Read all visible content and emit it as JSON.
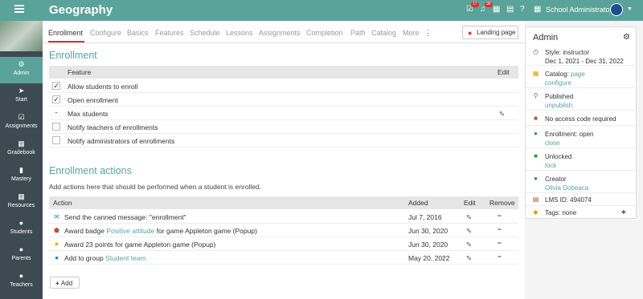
{
  "topbar": {
    "title": "Geography",
    "user": "School Administrator",
    "badge1": "17",
    "badge2": "38"
  },
  "sidebar": {
    "items": [
      {
        "label": "Admin",
        "icon": "gear-icon"
      },
      {
        "label": "Start",
        "icon": "arrow-icon"
      },
      {
        "label": "Assignments",
        "icon": "assignment-icon"
      },
      {
        "label": "Gradebook",
        "icon": "gradebook-icon"
      },
      {
        "label": "Mastery",
        "icon": "bar-chart-icon"
      },
      {
        "label": "Resources",
        "icon": "resources-icon"
      },
      {
        "label": "Students",
        "icon": "person-icon"
      },
      {
        "label": "Parents",
        "icon": "person-icon"
      },
      {
        "label": "Teachers",
        "icon": "person-icon"
      }
    ]
  },
  "tabs": [
    "Enrollment",
    "Configure",
    "Basics",
    "Features",
    "Schedule",
    "Lessons",
    "Assignments",
    "Completion",
    "Path",
    "Catalog",
    "More"
  ],
  "landing_page": "Landing page",
  "enrollment": {
    "title": "Enrollment",
    "col_feature": "Feature",
    "col_edit": "Edit",
    "rows": [
      {
        "checked": "✓",
        "label": "Allow students to enroll"
      },
      {
        "checked": "✓",
        "label": "Open enrollment"
      },
      {
        "checked": "-",
        "label": "Max students"
      },
      {
        "checked": "",
        "label": "Notify teachers of enrollments"
      },
      {
        "checked": "",
        "label": "Notify administrators of enrollments"
      }
    ]
  },
  "actions": {
    "title": "Enrollment actions",
    "description": "Add actions here that should be performed when a student is enrolled.",
    "col_action": "Action",
    "col_added": "Added",
    "col_edit": "Edit",
    "col_remove": "Remove",
    "rows": [
      {
        "pre": "Send the canned message: \"enrollment\"",
        "link": "",
        "post": "",
        "added": "Jul 7, 2016"
      },
      {
        "pre": "Award badge ",
        "link": "Positive attitude",
        "post": " for game Appleton game (Popup)",
        "added": "Jun 30, 2020"
      },
      {
        "pre": "Award 23 points for game Appleton game (Popup)",
        "link": "",
        "post": "",
        "added": "Jun 30, 2020"
      },
      {
        "pre": "Add to group ",
        "link": "Student team",
        "post": "",
        "added": "May 20, 2022"
      }
    ],
    "add_label": "Add"
  },
  "panel": {
    "title": "Admin",
    "style": "Style: instructor",
    "dates": "Dec 1, 2021 - Dec 31, 2022",
    "catalog_pre": "Catalog: ",
    "catalog_link": "page",
    "catalog_sub": "configure",
    "published": "Published",
    "published_sub": "unpublish",
    "access": "No access code required",
    "enroll": "Enrollment: open",
    "enroll_sub": "close",
    "unlocked": "Unlocked",
    "unlocked_sub": "lock",
    "creator": "Creator",
    "creator_sub": "Olivia Dobeaca",
    "lms": "LMS ID: 494074",
    "tags": "Tags: none"
  }
}
